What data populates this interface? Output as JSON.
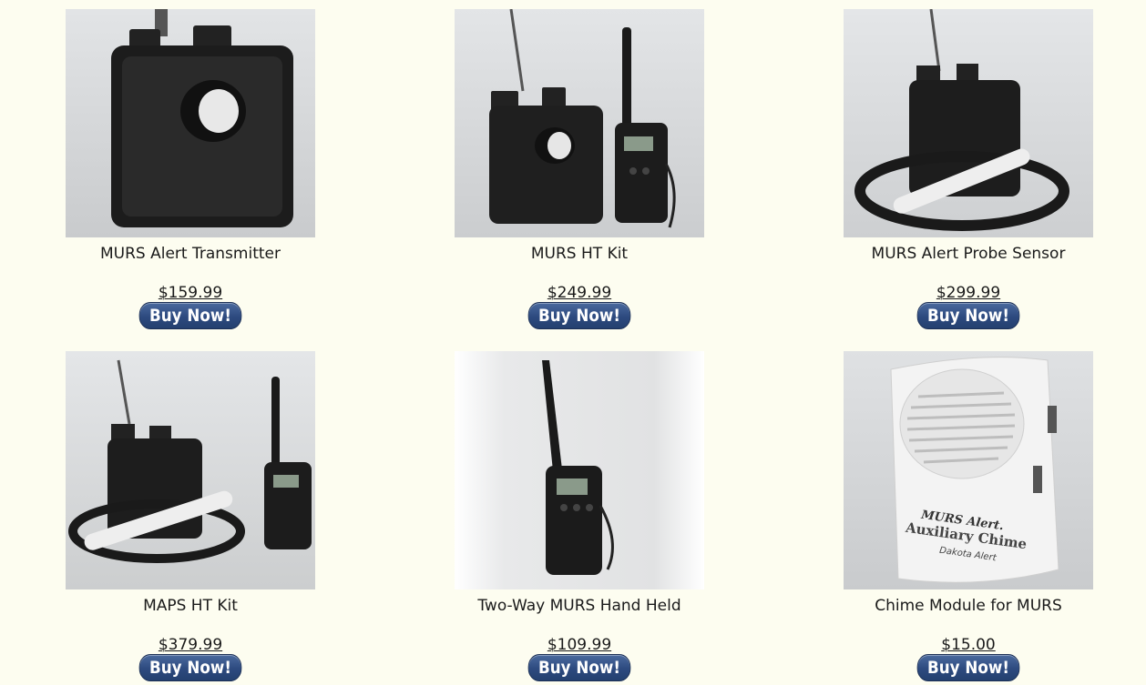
{
  "products": [
    {
      "name": "MURS Alert Transmitter",
      "price": "$159.99",
      "buy_label": "Buy Now!",
      "image": "transmitter-photo"
    },
    {
      "name": "MURS HT Kit",
      "price": "$249.99",
      "buy_label": "Buy Now!",
      "image": "ht-kit-photo"
    },
    {
      "name": "MURS Alert Probe Sensor",
      "price": "$299.99",
      "buy_label": "Buy Now!",
      "image": "probe-sensor-photo"
    },
    {
      "name": "MAPS HT Kit",
      "price": "$379.99",
      "buy_label": "Buy Now!",
      "image": "maps-ht-kit-photo"
    },
    {
      "name": "Two-Way MURS Hand Held",
      "price": "$109.99",
      "buy_label": "Buy Now!",
      "image": "hand-held-radio-photo"
    },
    {
      "name": "Chime Module for MURS",
      "price": "$15.00",
      "buy_label": "Buy Now!",
      "image": "chime-module-photo",
      "image_text": [
        "MURS Alert.",
        "Auxiliary Chime",
        "Dakota Alert"
      ]
    }
  ],
  "colors": {
    "background": "#fdfdf0",
    "button": "#2d4a7f",
    "text": "#1a1a1a"
  }
}
